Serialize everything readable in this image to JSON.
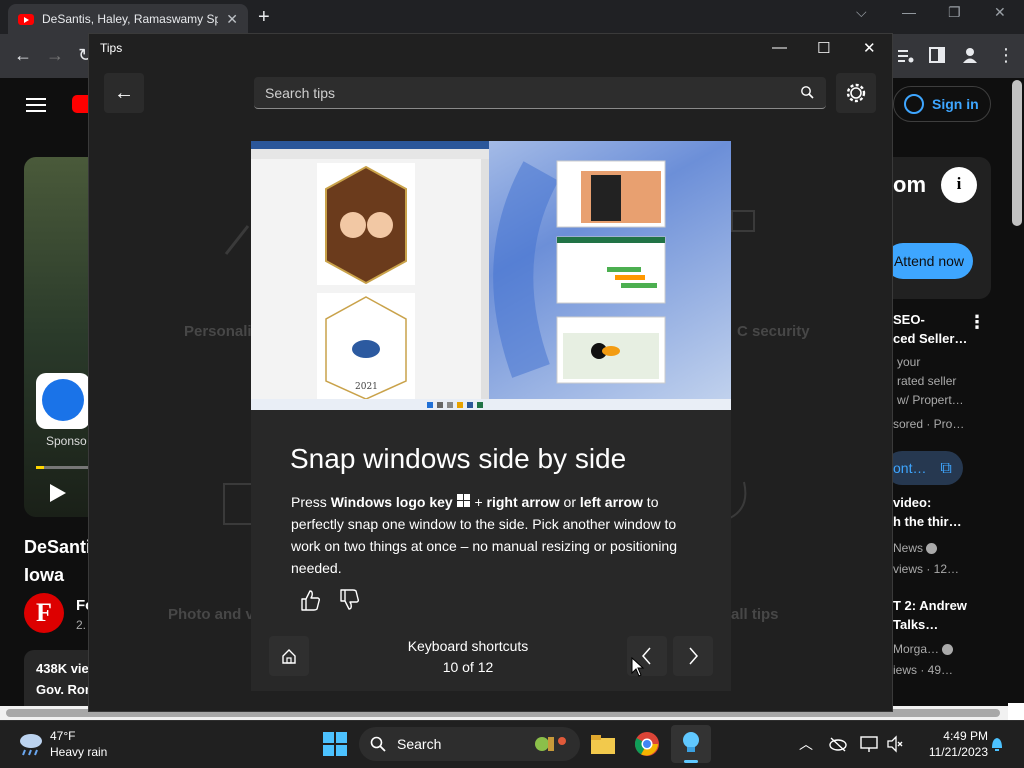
{
  "browser": {
    "tab_title": "DeSantis, Haley, Ramaswamy Sp",
    "tab_close": "✕",
    "new_tab": "+",
    "ctl_chevron": "⌵",
    "ctl_min": "—",
    "ctl_restore": "❐",
    "ctl_close": "✕"
  },
  "youtube": {
    "sponsored_label": "Sponso",
    "video_title_1": "DeSanti",
    "video_title_2": "Iowa",
    "channel_letter": "F",
    "channel_name": "Fo",
    "channel_sub": "2.",
    "views": "438K vie",
    "gov": "Gov. Ron",
    "sign_in": "Sign in",
    "ad_text": "om",
    "info": "i",
    "attend": "Attend now",
    "right_items": [
      {
        "l1": "SEO-",
        "l2": "ced Seller…",
        "l3": "your",
        "l4": "rated seller",
        "l5": "w/ Propert…",
        "l6": "sored · Pro…"
      },
      {
        "l1": "video:",
        "l2": "h the thir…",
        "l3": "News",
        "l4": "views  · 12…"
      },
      {
        "l1": "T 2: Andrew",
        "l2": "Talks…",
        "l3": "Morga…",
        "l4": "iews  · 49…"
      }
    ],
    "cont_btn": "ont…"
  },
  "tips": {
    "window_title": "Tips",
    "win_min": "—",
    "win_max": "☐",
    "win_close": "✕",
    "search_placeholder": "Search tips",
    "bg_categories": [
      "Personaliz",
      "C security",
      "Photo and v",
      "all tips"
    ],
    "tip_title": "Snap windows side by side",
    "body": {
      "p1": "Press ",
      "b1": "Windows logo key",
      "p2": " + ",
      "b2": "right arrow",
      "p3": " or ",
      "b3": "left arrow",
      "p4": " to perfectly snap one window to the side. Pick another window to work on two things at once – no manual resizing or positioning needed."
    },
    "category": "Keyboard shortcuts",
    "count": "10 of 12"
  },
  "taskbar": {
    "temp": "47°F",
    "weather": "Heavy rain",
    "search": "Search",
    "time": "4:49 PM",
    "date": "11/21/2023"
  }
}
